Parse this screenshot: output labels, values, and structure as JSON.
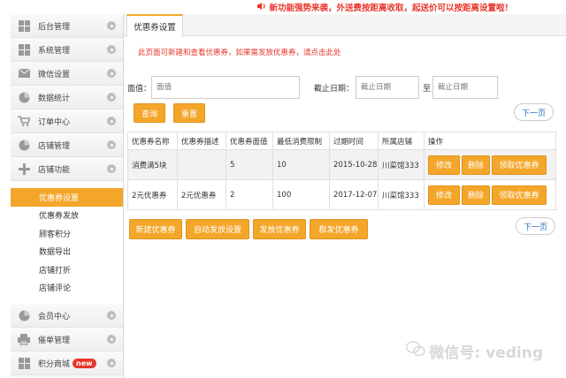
{
  "notice": {
    "text": "新功能强势来袭，外送费按距离收取，起送价可以按距离设置啦！"
  },
  "sidebar": {
    "items": [
      {
        "label": "后台管理",
        "icon": "grid-icon"
      },
      {
        "label": "系统管理",
        "icon": "grid-icon"
      },
      {
        "label": "微信设置",
        "icon": "envelope-icon"
      },
      {
        "label": "数据统计",
        "icon": "pie-chart-icon"
      },
      {
        "label": "订单中心",
        "icon": "cart-icon"
      },
      {
        "label": "店铺管理",
        "icon": "pie-chart-icon"
      },
      {
        "label": "店铺功能",
        "icon": "plus-icon"
      }
    ],
    "sub_items": [
      "优惠券设置",
      "优惠券发放",
      "顾客积分",
      "数据导出",
      "店铺打折",
      "店铺评论"
    ],
    "bottom_items": [
      {
        "label": "会员中心",
        "icon": "pie-chart-icon"
      },
      {
        "label": "催单管理",
        "icon": "printer-icon"
      },
      {
        "label": "积分商城",
        "icon": "grid-icon",
        "badge": "new"
      }
    ]
  },
  "tab": {
    "label": "优惠券设置"
  },
  "info": {
    "text": "此页面可新建和查看优惠券，如果需发放优惠券，请",
    "link": "点击此处"
  },
  "filter": {
    "value_label": "面值：",
    "value_placeholder": "面值",
    "date_label": "截止日期：",
    "date_from_placeholder": "截止日期",
    "to_label": "至",
    "date_to_placeholder": "截止日期",
    "query_btn": "查询",
    "reset_btn": "重置"
  },
  "pager": {
    "next": "下一页"
  },
  "table": {
    "headers": [
      "优惠券名称",
      "优惠券描述",
      "优惠券面值",
      "最低消费限制",
      "过期时间",
      "所属店铺",
      "操作"
    ],
    "rows": [
      {
        "name": "消费满5块",
        "desc": "",
        "value": "5",
        "min": "10",
        "expire": "2015-10-28",
        "shop": "川菜馆333"
      },
      {
        "name": "2元优惠券",
        "desc": "2元优惠券",
        "value": "2",
        "min": "100",
        "expire": "2017-12-07",
        "shop": "川菜馆333"
      }
    ],
    "ops": {
      "edit": "修改",
      "delete": "删除",
      "receive": "领取优惠券"
    }
  },
  "actions": {
    "create": "新建优惠券",
    "auto": "自动发放设置",
    "issue": "发放优惠券",
    "group": "群发优惠券"
  },
  "watermark": {
    "text": "微信号: veding"
  },
  "colors": {
    "accent": "#f4a62a",
    "notice": "#e8352a",
    "link": "#2a6bbd"
  }
}
